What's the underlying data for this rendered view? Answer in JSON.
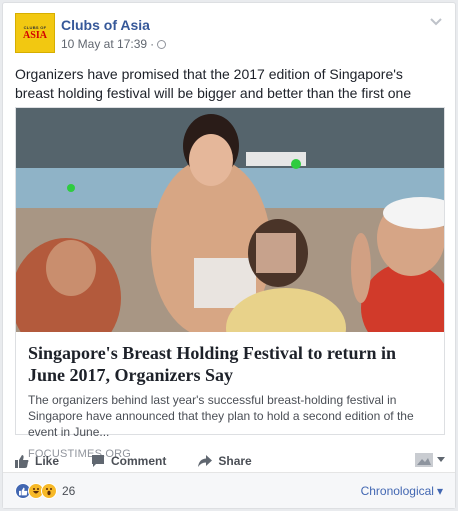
{
  "post": {
    "page_name": "Clubs of Asia",
    "avatar_small": "CLUBS OF",
    "avatar_big": "ASIA",
    "timestamp": "10 May at 17:39",
    "separator": "·",
    "text": "Organizers have promised that the 2017 edition of Singapore's breast holding festival will be bigger and better than the first one"
  },
  "link": {
    "title": "Singapore's Breast Holding Festival to return in June 2017, Organizers Say",
    "description": "The organizers behind last year's successful breast-holding festival in Singapore have announced that they plan to hold a second edition of the event in June...",
    "domain": "FOCUSTIMES.ORG"
  },
  "actions": {
    "like": "Like",
    "comment": "Comment",
    "share": "Share"
  },
  "footer": {
    "reaction_count": "26",
    "sort_label": "Chronological",
    "sort_caret": "▾"
  },
  "icons": {
    "like": "thumbs-up-icon",
    "comment": "speech-bubble-icon",
    "share": "share-arrow-icon",
    "globe": "globe-icon",
    "reactions": [
      "like-reaction-icon",
      "haha-reaction-icon",
      "wow-reaction-icon"
    ]
  },
  "colors": {
    "link_blue": "#365899",
    "action_gray": "#4b4f56",
    "reaction_like": "#4267b2",
    "reaction_haha": "#f7b928"
  }
}
